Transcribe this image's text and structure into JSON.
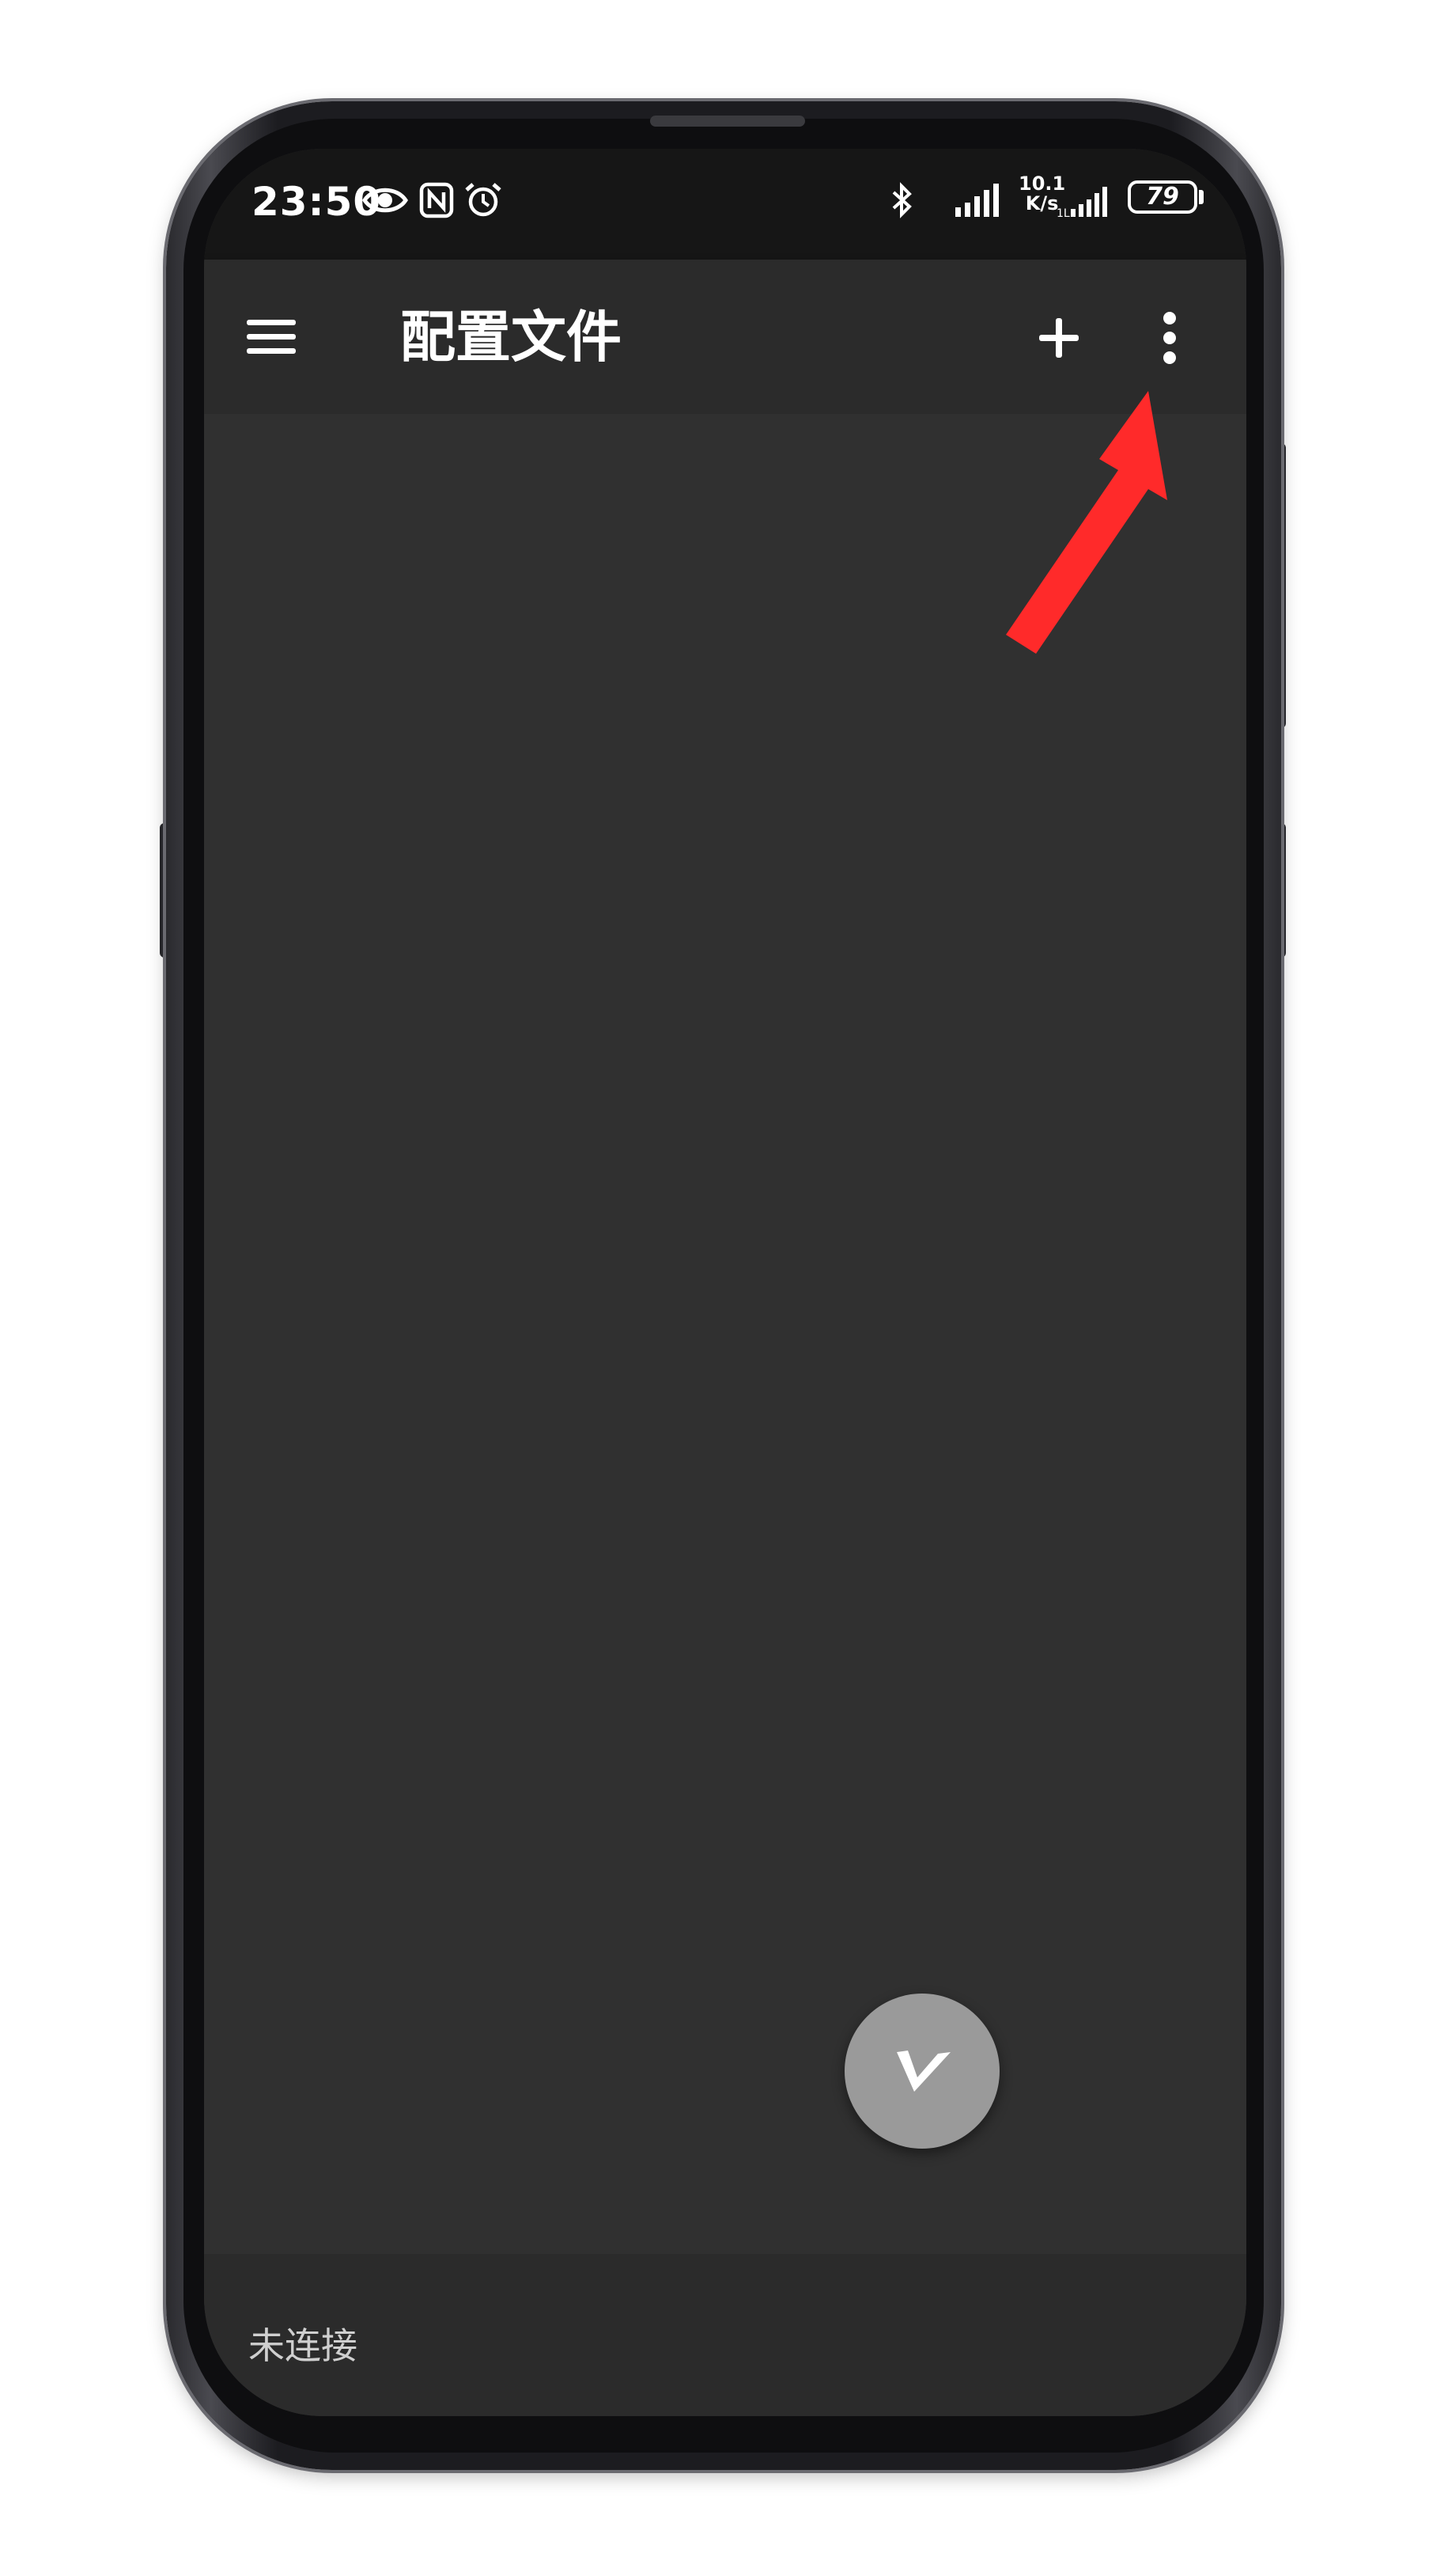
{
  "status_bar": {
    "time": "23:50",
    "net_speed_value": "10.1",
    "net_speed_unit": "K/s",
    "battery": "79",
    "icons": [
      "eye-icon",
      "nfc-icon",
      "alarm-icon",
      "bluetooth-icon",
      "signal-icon",
      "signal-icon"
    ]
  },
  "app_bar": {
    "title": "配置文件",
    "icons": [
      "menu-icon",
      "plus-icon",
      "more-vertical-icon"
    ]
  },
  "bottom_bar": {
    "status": "未连接"
  },
  "fab": {
    "icon": "v-logo-icon"
  },
  "colors": {
    "background": "#303030",
    "app_bar": "#2b2b2b",
    "status_bar": "#161616",
    "fab": "#9a9a9a",
    "annotation_arrow": "#ff2a2a"
  }
}
